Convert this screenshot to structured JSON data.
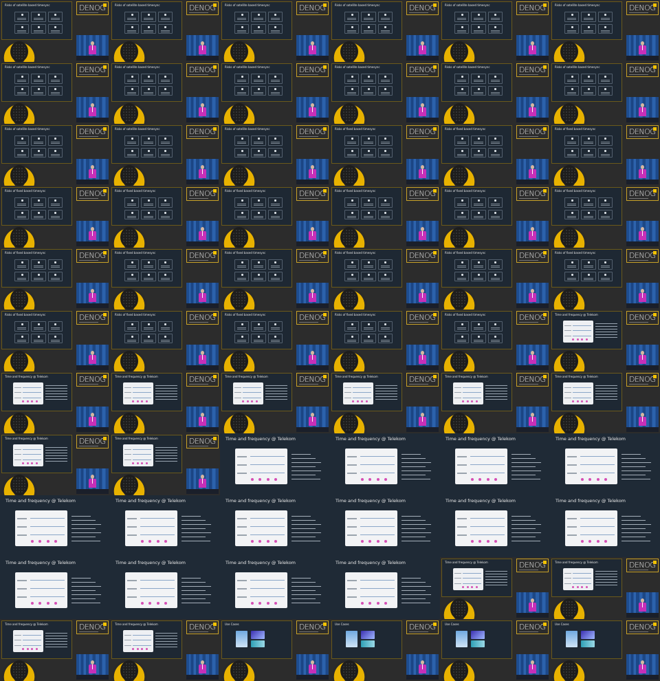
{
  "logo_text": "DENOG",
  "colors": {
    "background": "#2b2b2b",
    "slide_bg": "#1e2833",
    "accent_yellow": "#e8b200",
    "speaker_shirt": "#c72fb8",
    "curtain_blue": "#2a5fa8"
  },
  "grid": {
    "columns": 6,
    "rows": 11
  },
  "titles": {
    "sat": "Risks of satellite based timesync",
    "fixed": "Risks of fixed based timesync",
    "tf": "Time and frequency @ Telekom",
    "uc": "Use Cases"
  },
  "tiles": [
    "sat",
    "sat",
    "sat",
    "sat",
    "sat",
    "sat",
    "sat",
    "sat",
    "sat",
    "sat",
    "sat",
    "sat",
    "sat",
    "sat",
    "sat",
    "fixed",
    "fixed",
    "fixed",
    "fixed",
    "fixed",
    "fixed",
    "fixed",
    "fixed",
    "fixed",
    "fixed",
    "fixed",
    "fixed",
    "fixed",
    "fixed",
    "fixed",
    "fixed",
    "fixed",
    "fixed",
    "fixed",
    "fixed",
    "tf",
    "tf",
    "tf",
    "tf",
    "tf",
    "tf",
    "tf",
    "tf",
    "tf",
    "tf-full",
    "tf-full",
    "tf-full",
    "tf-full",
    "tf-full",
    "tf-full",
    "tf-full",
    "tf-full",
    "tf-full",
    "tf-full",
    "tf-full",
    "tf-full",
    "tf-full",
    "tf-full",
    "tf",
    "tf",
    "tf",
    "tf",
    "uc",
    "uc",
    "uc",
    "uc"
  ]
}
